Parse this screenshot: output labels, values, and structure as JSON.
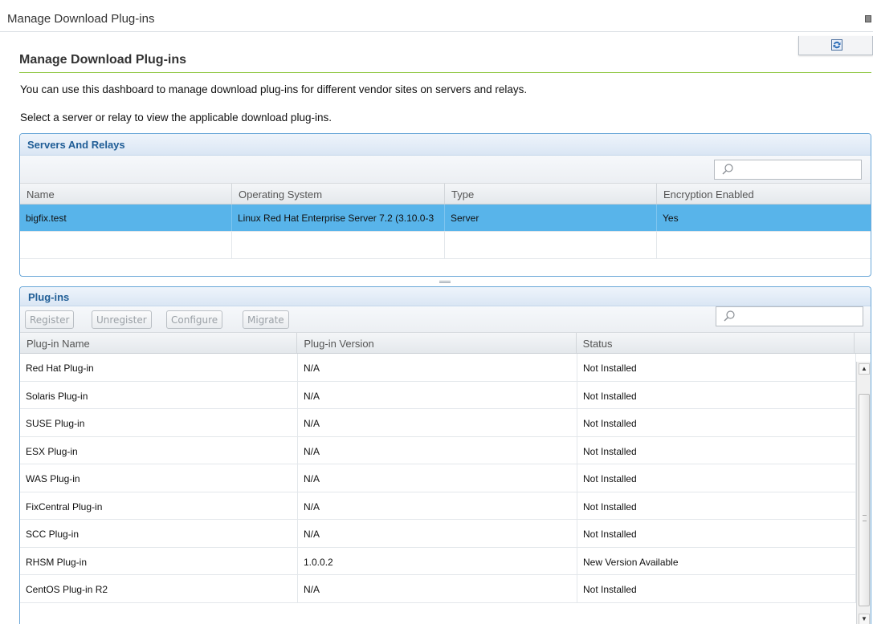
{
  "window": {
    "title": "Manage Download Plug-ins"
  },
  "page": {
    "heading": "Manage Download Plug-ins",
    "description": "You can use this dashboard to manage download plug-ins for different vendor sites on servers and relays.",
    "instruction": "Select a server or relay to view the applicable download plug-ins."
  },
  "servers": {
    "title": "Servers And Relays",
    "search_placeholder": "",
    "columns": [
      "Name",
      "Operating System",
      "Type",
      "Encryption Enabled"
    ],
    "rows": [
      {
        "name": "bigfix.test",
        "os": "Linux Red Hat Enterprise Server 7.2 (3.10.0-3",
        "type": "Server",
        "encryption": "Yes",
        "selected": true
      }
    ]
  },
  "plugins": {
    "title": "Plug-ins",
    "buttons": {
      "register": "Register",
      "unregister": "Unregister",
      "configure": "Configure",
      "migrate": "Migrate"
    },
    "search_placeholder": "",
    "columns": [
      "Plug-in Name",
      "Plug-in Version",
      "Status"
    ],
    "rows": [
      {
        "name": "Red Hat Plug-in",
        "version": "N/A",
        "status": "Not Installed"
      },
      {
        "name": "Solaris Plug-in",
        "version": "N/A",
        "status": "Not Installed"
      },
      {
        "name": "SUSE Plug-in",
        "version": "N/A",
        "status": "Not Installed"
      },
      {
        "name": "ESX Plug-in",
        "version": "N/A",
        "status": "Not Installed"
      },
      {
        "name": "WAS Plug-in",
        "version": "N/A",
        "status": "Not Installed"
      },
      {
        "name": "FixCentral Plug-in",
        "version": "N/A",
        "status": "Not Installed"
      },
      {
        "name": "SCC Plug-in",
        "version": "N/A",
        "status": "Not Installed"
      },
      {
        "name": "RHSM Plug-in",
        "version": "1.0.0.2",
        "status": "New Version Available"
      },
      {
        "name": "CentOS Plug-in R2",
        "version": "N/A",
        "status": "Not Installed"
      }
    ]
  },
  "colors": {
    "panel_border": "#6aa7d8",
    "header_text": "#1f5d96",
    "selected_row": "#58b4ea",
    "heading_rule": "#8dc63f"
  },
  "icons": {
    "refresh": "refresh-icon",
    "search": "search-icon",
    "scroll_up": "scroll-up-icon",
    "scroll_down": "scroll-down-icon"
  }
}
